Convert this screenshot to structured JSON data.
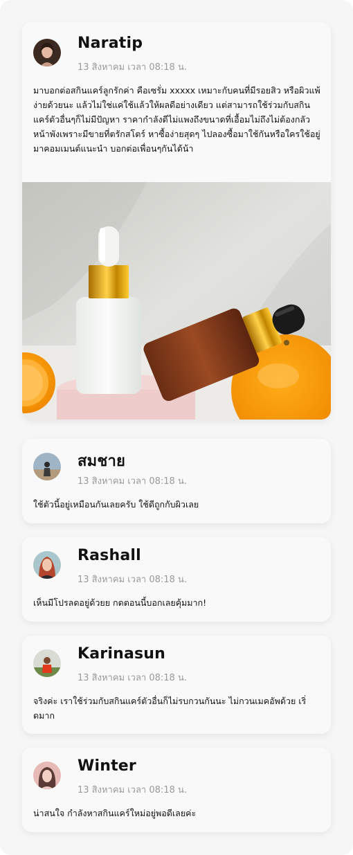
{
  "posts": [
    {
      "author": "Naratip",
      "timestamp": "13 สิงหาคม เวลา 08:18 น.",
      "text": "มาบอกต่อสกินแคร์ลูกรักค่า คือเซรั่ม xxxxx เหมาะกับคนที่มีรอยสิว หรือผิวแพ้ง่ายด้วยนะ แล้วไม่ใช่แค่ใช้แล้วให้ผลดีอย่างเดียว แต่สามารถใช้ร่วมกับสกินแคร์ตัวอื่นๆก็ไม่มีปัญหา ราคากำลังดีไม่แพงถึงขนาดที่เอื้อมไม่ถึงไม่ต้องกลัวหน้าพังเพราะมีขายที่ตรักสโตร์ หาซื้อง่ายสุดๆ ไปลองซื้อมาใช้กันหรือใครใช้อยู่มาคอมเมนต์แนะนำ บอกต่อเพื่อนๆกันได้น้า"
    },
    {
      "author": "สมชาย",
      "timestamp": "13 สิงหาคม เวลา 08:18 น.",
      "text": "ใช้ตัวนี้อยู่เหมือนกันเลยครับ ใช้ดีถูกกับผิวเลย"
    },
    {
      "author": "Rashall",
      "timestamp": "13 สิงหาคม เวลา 08:18 น.",
      "text": "เห็นมีโปรลดอยู่ด้วยย กดตอนนี้บอกเลยคุ้มมาก!"
    },
    {
      "author": "Karinasun",
      "timestamp": "13 สิงหาคม เวลา 08:18 น.",
      "text": "จริงค่ะ เราใช้ร่วมกับสกินแคร์ตัวอื่นก็ไม่รบกวนกันนะ ไม่กวนเมคอัพด้วย เริ่ดมาก"
    },
    {
      "author": "Winter",
      "timestamp": "13 สิงหาคม เวลา 08:18 น.",
      "text": "น่าสนใจ กำลังหาสกินแคร์ใหม่อยู่พอดีเลยค่ะ"
    }
  ]
}
